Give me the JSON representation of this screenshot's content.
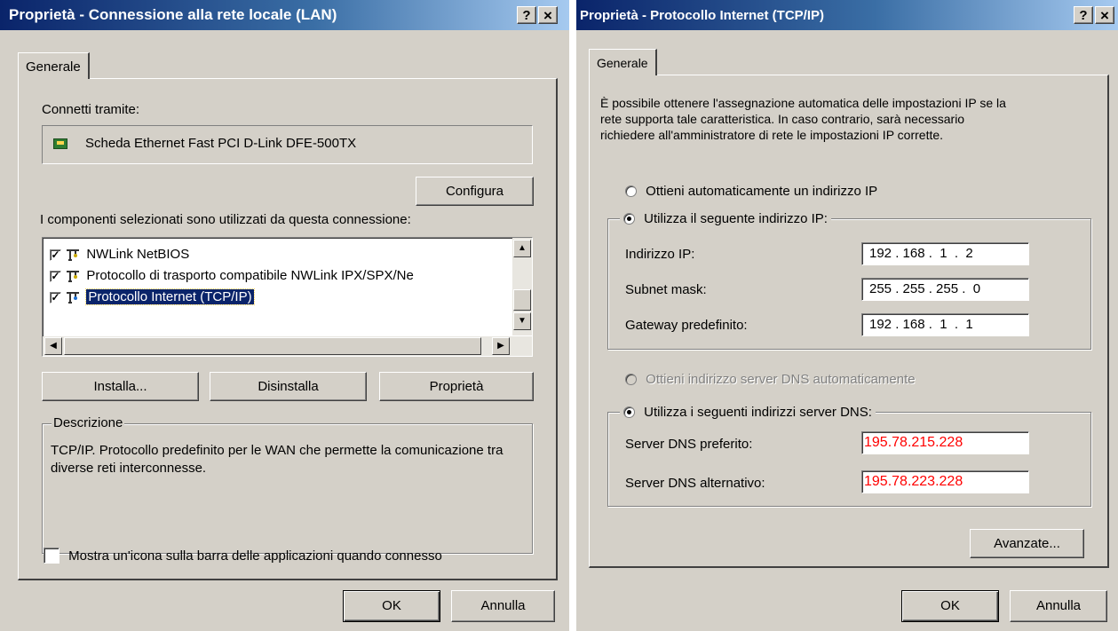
{
  "left": {
    "title": "Proprietà - Connessione alla rete locale (LAN)",
    "help_glyph": "?",
    "close_glyph": "×",
    "tab_general": "Generale",
    "connect_via_label": "Connetti tramite:",
    "adapter_name": "Scheda Ethernet Fast PCI D-Link DFE-500TX",
    "configure_button": "Configura",
    "components_label": "I componenti selezionati sono utilizzati da questa connessione:",
    "components": [
      {
        "label": "NWLink NetBIOS",
        "checked": true,
        "selected": false
      },
      {
        "label": "Protocollo di trasporto compatibile NWLink IPX/SPX/Ne",
        "checked": true,
        "selected": false
      },
      {
        "label": "Protocollo Internet (TCP/IP)",
        "checked": true,
        "selected": true
      }
    ],
    "install_button": "Installa...",
    "uninstall_button": "Disinstalla",
    "properties_button": "Proprietà",
    "description_legend": "Descrizione",
    "description_text": "TCP/IP. Protocollo predefinito per le WAN che permette la comunicazione tra diverse reti interconnesse.",
    "show_icon_label": "Mostra un'icona sulla barra delle applicazioni quando connesso",
    "ok_button": "OK",
    "cancel_button": "Annulla"
  },
  "right": {
    "title": "Proprietà - Protocollo Internet (TCP/IP)",
    "help_glyph": "?",
    "close_glyph": "×",
    "tab_general": "Generale",
    "intro_line1": "È possibile ottenere l'assegnazione automatica delle impostazioni IP se la",
    "intro_line2": "rete supporta tale caratteristica. In caso contrario, sarà necessario",
    "intro_line3": "richiedere all'amministratore di rete le impostazioni IP corrette.",
    "radio_auto_ip": "Ottieni automaticamente un indirizzo IP",
    "radio_manual_ip": "Utilizza il seguente indirizzo IP:",
    "ip_label": "Indirizzo IP:",
    "ip_value": "192 . 168 .  1  .  2",
    "subnet_label": "Subnet mask:",
    "subnet_value": "255 . 255 . 255 .  0",
    "gateway_label": "Gateway predefinito:",
    "gateway_value": "192 . 168 .  1  .  1",
    "radio_auto_dns": "Ottieni indirizzo server DNS automaticamente",
    "radio_manual_dns": "Utilizza i seguenti indirizzi server DNS:",
    "dns_pref_label": "Server DNS preferito:",
    "dns_pref_value": "195.78.215.228",
    "dns_alt_label": "Server DNS alternativo:",
    "dns_alt_value": "195.78.223.228",
    "advanced_button": "Avanzate...",
    "ok_button": "OK",
    "cancel_button": "Annulla"
  },
  "colors": {
    "title_gradient_start": "#0a246a",
    "title_gradient_end": "#a6caf0",
    "dialog_face": "#d4d0c8",
    "selection": "#0a246a",
    "dns_value_text": "#ff0000"
  }
}
